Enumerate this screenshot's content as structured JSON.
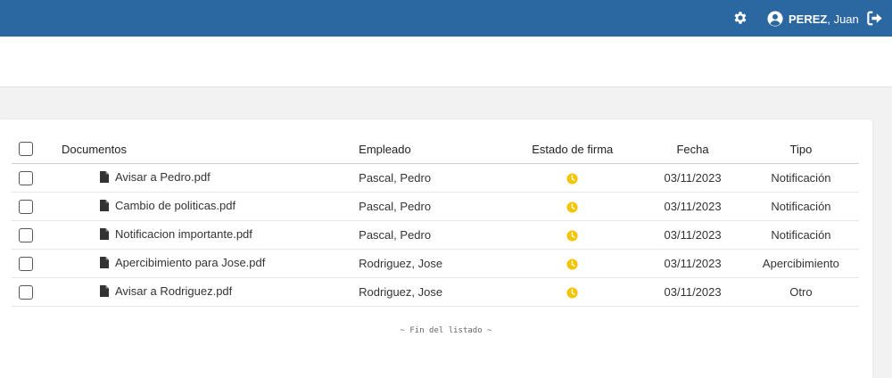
{
  "header": {
    "user_last": "PEREZ",
    "user_first": ", Juan",
    "icons": [
      "gear-icon",
      "user-circle-icon",
      "logout-icon"
    ],
    "accent": "#2b67a0"
  },
  "table": {
    "columns": [
      "Documentos",
      "Empleado",
      "Estado de firma",
      "Fecha",
      "Tipo"
    ],
    "rows": [
      {
        "documento": "Avisar a Pedro.pdf",
        "empleado": "Pascal, Pedro",
        "estado": "pendiente",
        "fecha": "03/11/2023",
        "tipo": "Notificación"
      },
      {
        "documento": "Cambio de politicas.pdf",
        "empleado": "Pascal, Pedro",
        "estado": "pendiente",
        "fecha": "03/11/2023",
        "tipo": "Notificación"
      },
      {
        "documento": "Notificacion importante.pdf",
        "empleado": "Pascal, Pedro",
        "estado": "pendiente",
        "fecha": "03/11/2023",
        "tipo": "Notificación"
      },
      {
        "documento": "Apercibimiento para Jose.pdf",
        "empleado": "Rodriguez, Jose",
        "estado": "pendiente",
        "fecha": "03/11/2023",
        "tipo": "Apercibimiento"
      },
      {
        "documento": "Avisar a Rodriguez.pdf",
        "empleado": "Rodriguez, Jose",
        "estado": "pendiente",
        "fecha": "03/11/2023",
        "tipo": "Otro"
      }
    ],
    "status_color": "#f2c500"
  },
  "footer": {
    "end_text": "~ Fin del listado ~"
  }
}
